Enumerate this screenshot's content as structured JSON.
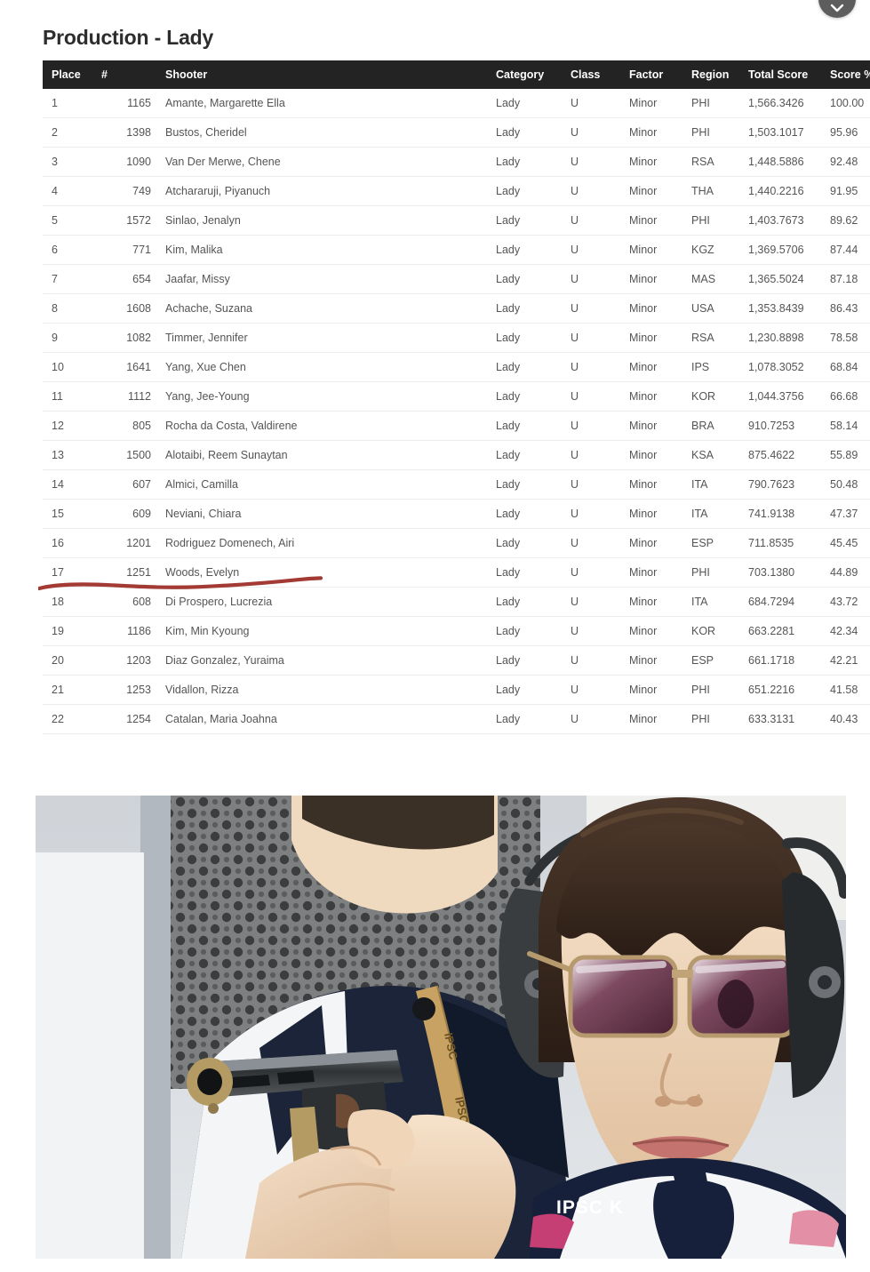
{
  "float_button": {
    "name": "scroll-down-button",
    "icon": "chevron-down-icon",
    "color": "#5d5d5d"
  },
  "page_title": "Production - Lady",
  "table": {
    "headers": {
      "place": "Place",
      "number": "#",
      "shooter": "Shooter",
      "category": "Category",
      "class": "Class",
      "factor": "Factor",
      "region": "Region",
      "total_score": "Total Score",
      "score_pct": "Score %"
    },
    "header_bg": "#232323",
    "rows": [
      {
        "place": "1",
        "number": "1165",
        "shooter": "Amante, Margarette Ella",
        "category": "Lady",
        "class": "U",
        "factor": "Minor",
        "region": "PHI",
        "total_score": "1,566.3426",
        "score_pct": "100.00"
      },
      {
        "place": "2",
        "number": "1398",
        "shooter": "Bustos, Cheridel",
        "category": "Lady",
        "class": "U",
        "factor": "Minor",
        "region": "PHI",
        "total_score": "1,503.1017",
        "score_pct": "95.96"
      },
      {
        "place": "3",
        "number": "1090",
        "shooter": "Van Der Merwe, Chene",
        "category": "Lady",
        "class": "U",
        "factor": "Minor",
        "region": "RSA",
        "total_score": "1,448.5886",
        "score_pct": "92.48"
      },
      {
        "place": "4",
        "number": "749",
        "shooter": "Atchararuji, Piyanuch",
        "category": "Lady",
        "class": "U",
        "factor": "Minor",
        "region": "THA",
        "total_score": "1,440.2216",
        "score_pct": "91.95"
      },
      {
        "place": "5",
        "number": "1572",
        "shooter": "Sinlao, Jenalyn",
        "category": "Lady",
        "class": "U",
        "factor": "Minor",
        "region": "PHI",
        "total_score": "1,403.7673",
        "score_pct": "89.62"
      },
      {
        "place": "6",
        "number": "771",
        "shooter": "Kim, Malika",
        "category": "Lady",
        "class": "U",
        "factor": "Minor",
        "region": "KGZ",
        "total_score": "1,369.5706",
        "score_pct": "87.44"
      },
      {
        "place": "7",
        "number": "654",
        "shooter": "Jaafar, Missy",
        "category": "Lady",
        "class": "U",
        "factor": "Minor",
        "region": "MAS",
        "total_score": "1,365.5024",
        "score_pct": "87.18"
      },
      {
        "place": "8",
        "number": "1608",
        "shooter": "Achache, Suzana",
        "category": "Lady",
        "class": "U",
        "factor": "Minor",
        "region": "USA",
        "total_score": "1,353.8439",
        "score_pct": "86.43"
      },
      {
        "place": "9",
        "number": "1082",
        "shooter": "Timmer, Jennifer",
        "category": "Lady",
        "class": "U",
        "factor": "Minor",
        "region": "RSA",
        "total_score": "1,230.8898",
        "score_pct": "78.58"
      },
      {
        "place": "10",
        "number": "1641",
        "shooter": "Yang, Xue Chen",
        "category": "Lady",
        "class": "U",
        "factor": "Minor",
        "region": "IPS",
        "total_score": "1,078.3052",
        "score_pct": "68.84"
      },
      {
        "place": "11",
        "number": "1112",
        "shooter": "Yang, Jee-Young",
        "category": "Lady",
        "class": "U",
        "factor": "Minor",
        "region": "KOR",
        "total_score": "1,044.3756",
        "score_pct": "66.68"
      },
      {
        "place": "12",
        "number": "805",
        "shooter": "Rocha da Costa, Valdirene",
        "category": "Lady",
        "class": "U",
        "factor": "Minor",
        "region": "BRA",
        "total_score": "910.7253",
        "score_pct": "58.14"
      },
      {
        "place": "13",
        "number": "1500",
        "shooter": "Alotaibi, Reem Sunaytan",
        "category": "Lady",
        "class": "U",
        "factor": "Minor",
        "region": "KSA",
        "total_score": "875.4622",
        "score_pct": "55.89"
      },
      {
        "place": "14",
        "number": "607",
        "shooter": "Almici, Camilla",
        "category": "Lady",
        "class": "U",
        "factor": "Minor",
        "region": "ITA",
        "total_score": "790.7623",
        "score_pct": "50.48"
      },
      {
        "place": "15",
        "number": "609",
        "shooter": "Neviani, Chiara",
        "category": "Lady",
        "class": "U",
        "factor": "Minor",
        "region": "ITA",
        "total_score": "741.9138",
        "score_pct": "47.37"
      },
      {
        "place": "16",
        "number": "1201",
        "shooter": "Rodriguez Domenech, Airi",
        "category": "Lady",
        "class": "U",
        "factor": "Minor",
        "region": "ESP",
        "total_score": "711.8535",
        "score_pct": "45.45"
      },
      {
        "place": "17",
        "number": "1251",
        "shooter": "Woods, Evelyn",
        "category": "Lady",
        "class": "U",
        "factor": "Minor",
        "region": "PHI",
        "total_score": "703.1380",
        "score_pct": "44.89"
      },
      {
        "place": "18",
        "number": "608",
        "shooter": "Di Prospero, Lucrezia",
        "category": "Lady",
        "class": "U",
        "factor": "Minor",
        "region": "ITA",
        "total_score": "684.7294",
        "score_pct": "43.72"
      },
      {
        "place": "19",
        "number": "1186",
        "shooter": "Kim, Min Kyoung",
        "category": "Lady",
        "class": "U",
        "factor": "Minor",
        "region": "KOR",
        "total_score": "663.2281",
        "score_pct": "42.34"
      },
      {
        "place": "20",
        "number": "1203",
        "shooter": "Diaz Gonzalez, Yuraima",
        "category": "Lady",
        "class": "U",
        "factor": "Minor",
        "region": "ESP",
        "total_score": "661.1718",
        "score_pct": "42.21"
      },
      {
        "place": "21",
        "number": "1253",
        "shooter": "Vidallon, Rizza",
        "category": "Lady",
        "class": "U",
        "factor": "Minor",
        "region": "PHI",
        "total_score": "651.2216",
        "score_pct": "41.58"
      },
      {
        "place": "22",
        "number": "1254",
        "shooter": "Catalan, Maria Joahna",
        "category": "Lady",
        "class": "U",
        "factor": "Minor",
        "region": "PHI",
        "total_score": "633.3131",
        "score_pct": "40.43"
      }
    ]
  },
  "annotation": {
    "name": "red-underline-row-19",
    "color": "#a33a33",
    "targets_row_place": "19"
  },
  "photo": {
    "name": "shooter-photo",
    "description": "Two competitors at an IPSC pistol match; foreground woman in sunglasses and ear protection aiming a pistol",
    "jersey_text": "IPSC K",
    "lanyard_text": "IPSC"
  }
}
